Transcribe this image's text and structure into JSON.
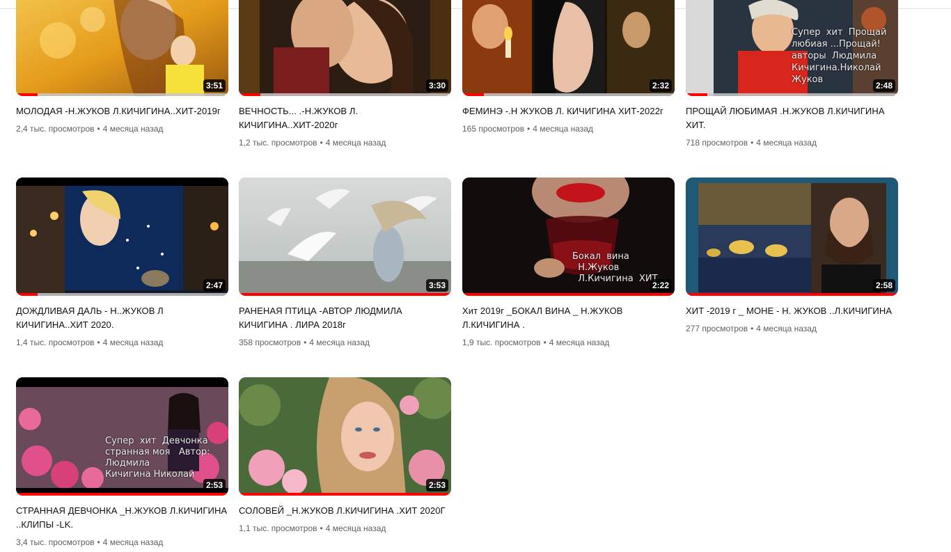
{
  "videos": [
    {
      "title": "МОЛОДАЯ -Н.ЖУКОВ Л.КИЧИГИНА..ХИТ-2019г",
      "views": "2,4 тыс. просмотров",
      "age": "4 месяца назад",
      "duration": "3:51",
      "watched_fraction": 0.1,
      "overlay": ""
    },
    {
      "title": "ВЕЧНОСТЬ... .-Н.ЖУКОВ Л. КИЧИГИНА..ХИТ-2020г",
      "views": "1,2 тыс. просмотров",
      "age": "4 месяца назад",
      "duration": "3:30",
      "watched_fraction": 0.1,
      "overlay": ""
    },
    {
      "title": "ФЕМИНЭ -.Н ЖУКОВ Л. КИЧИГИНА ХИТ-2022г",
      "views": "165 просмотров",
      "age": "4 месяца назад",
      "duration": "2:32",
      "watched_fraction": 0.1,
      "overlay": ""
    },
    {
      "title": "ПРОЩАЙ ЛЮБИМАЯ .Н.ЖУКОВ Л.КИЧИГИНА ХИТ.",
      "views": "718 просмотров",
      "age": "4 месяца назад",
      "duration": "2:48",
      "watched_fraction": 0.1,
      "overlay": "Супер  хит  Прощай\nлюбиая ...Прощай!\nавторы  Людмила\nКичигина.Николай\nЖуков"
    },
    {
      "title": "ДОЖДЛИВАЯ ДАЛЬ - Н..ЖУКОВ Л КИЧИГИНА..ХИТ 2020.",
      "views": "1,4 тыс. просмотров",
      "age": "4 месяца назад",
      "duration": "2:47",
      "watched_fraction": 0.1,
      "overlay": ""
    },
    {
      "title": "РАНЕНАЯ ПТИЦА -АВТОР ЛЮДМИЛА КИЧИГИНА . ЛИРА 2018г",
      "views": "358 просмотров",
      "age": "4 месяца назад",
      "duration": "3:53",
      "watched_fraction": 1.0,
      "overlay": ""
    },
    {
      "title": "Хит 2019г _БОКАЛ ВИНА _ Н.ЖУКОВ Л.КИЧИГИНА .",
      "views": "1,9 тыс. просмотров",
      "age": "4 месяца назад",
      "duration": "2:22",
      "watched_fraction": 1.0,
      "overlay": "Бокал  вина\n  Н.Жуков\n  Л.Кичигина  ХИТ"
    },
    {
      "title": "ХИТ -2019 г _ МОНЕ - Н. ЖУКОВ ..Л.КИЧИГИНА",
      "views": "277 просмотров",
      "age": "4 месяца назад",
      "duration": "2:58",
      "watched_fraction": 1.0,
      "overlay": ""
    },
    {
      "title": "СТРАННАЯ ДЕВЧОНКА _Н.ЖУКОВ Л.КИЧИГИНА ..КЛИПЫ -LK.",
      "views": "3,4 тыс. просмотров",
      "age": "4 месяца назад",
      "duration": "2:53",
      "watched_fraction": 1.0,
      "overlay": "Супер  хит  Девчонка\nстранная моя   Автор:\nЛюдмила\nКичигина Николай"
    },
    {
      "title": "СОЛОВЕЙ _Н.ЖУКОВ Л.КИЧИГИНА .ХИТ 2020Г",
      "views": "1,1 тыс. просмотров",
      "age": "4 месяца назад",
      "duration": "2:53",
      "watched_fraction": 1.0,
      "overlay": ""
    }
  ],
  "separator": "•",
  "colors": {
    "accent": "#ff0000",
    "meta_text": "#606060",
    "title_text": "#0f0f0f"
  }
}
